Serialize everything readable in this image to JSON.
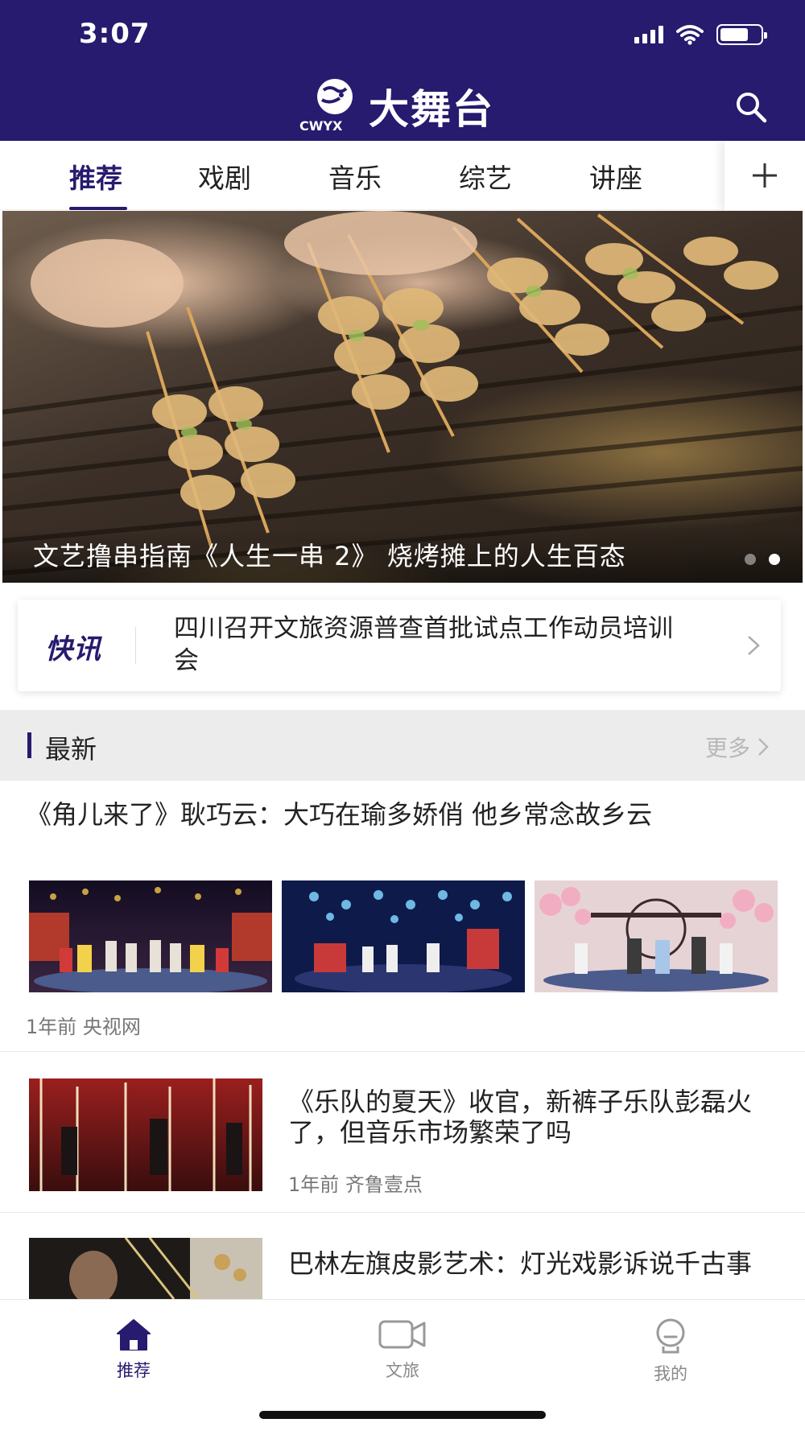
{
  "status_bar": {
    "time": "3:07"
  },
  "header": {
    "logo_text": "大舞台",
    "logo_sub": "CWYX",
    "search_icon": "search-icon",
    "bg_color": "#261b6e"
  },
  "tabs": {
    "items": [
      {
        "label": "推荐",
        "active": true
      },
      {
        "label": "戏剧",
        "active": false
      },
      {
        "label": "音乐",
        "active": false
      },
      {
        "label": "综艺",
        "active": false
      },
      {
        "label": "讲座",
        "active": false
      }
    ],
    "add_icon": "plus-icon"
  },
  "banner": {
    "title": "文艺撸串指南《人生一串 2》 烧烤摊上的人生百态",
    "dots": 2,
    "active_dot": 2
  },
  "flash": {
    "tag": "快讯",
    "text": "四川召开文旅资源普查首批试点工作动员培训会",
    "chevron_icon": "chevron-right-icon"
  },
  "section": {
    "title": "最新",
    "more_label": "更多"
  },
  "articles": [
    {
      "title": "《角儿来了》耿巧云：大巧在瑜多娇俏 他乡常念故乡云",
      "meta": "1年前 央视网"
    },
    {
      "title": "《乐队的夏天》收官，新裤子乐队彭磊火了，但音乐市场繁荣了吗",
      "meta": "1年前 齐鲁壹点"
    },
    {
      "title": "巴林左旗皮影艺术：灯光戏影诉说千古事",
      "meta": ""
    }
  ],
  "bottom_nav": {
    "items": [
      {
        "label": "推荐",
        "icon": "home-icon",
        "active": true
      },
      {
        "label": "文旅",
        "icon": "video-camera-icon",
        "active": false
      },
      {
        "label": "我的",
        "icon": "user-icon",
        "active": false
      }
    ],
    "active_color": "#261b6e",
    "inactive_color": "#888888"
  }
}
